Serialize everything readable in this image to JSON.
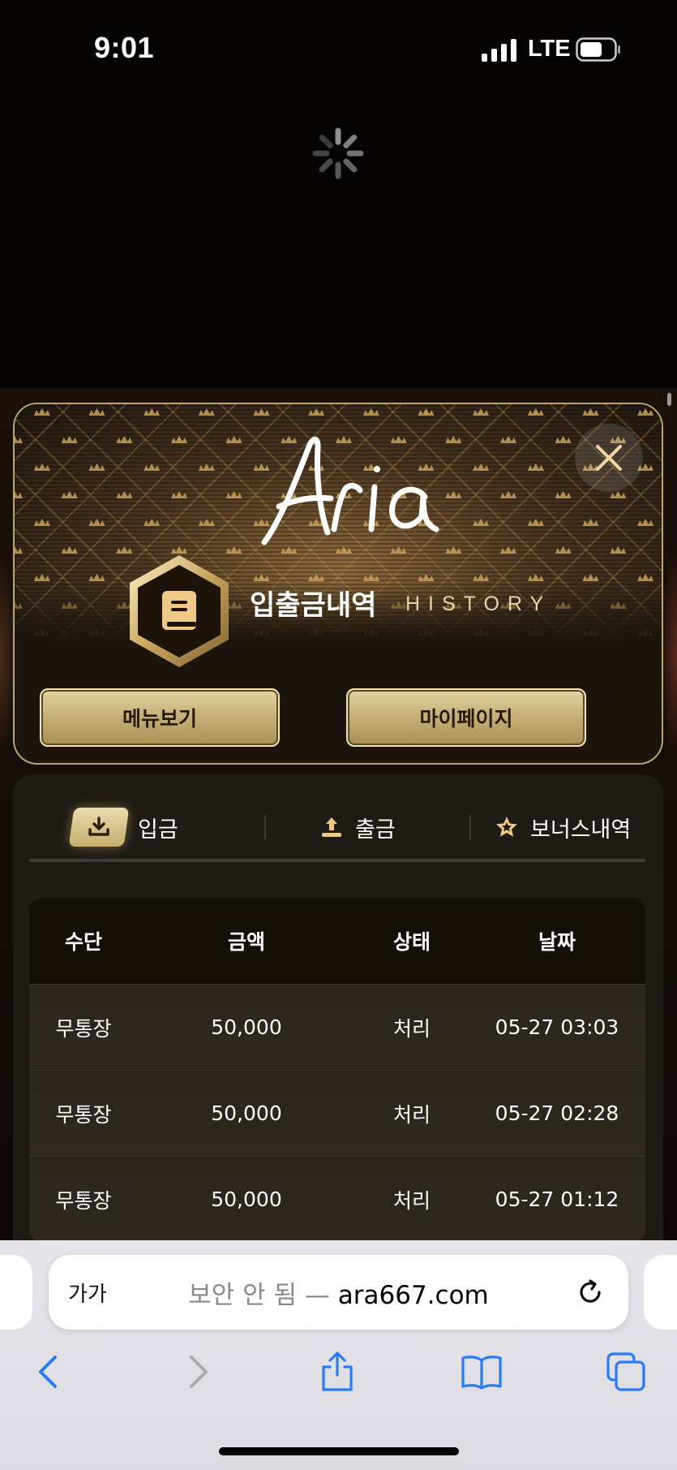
{
  "status_bar": {
    "time": "9:01",
    "network": "LTE"
  },
  "modal": {
    "logo_text": "Aria",
    "title_ko": "입출금내역",
    "title_en": "HISTORY",
    "menu_button": "메뉴보기",
    "mypage_button": "마이페이지"
  },
  "tabs": [
    {
      "label": "입금",
      "icon": "download-icon",
      "active": true
    },
    {
      "label": "출금",
      "icon": "upload-icon",
      "active": false
    },
    {
      "label": "보너스내역",
      "icon": "star-icon",
      "active": false
    }
  ],
  "table": {
    "headers": [
      "수단",
      "금액",
      "상태",
      "날짜"
    ],
    "rows": [
      [
        "무통장",
        "50,000",
        "처리",
        "05-27 03:03"
      ],
      [
        "무통장",
        "50,000",
        "처리",
        "05-27 02:28"
      ],
      [
        "무통장",
        "50,000",
        "처리",
        "05-27 01:12"
      ]
    ]
  },
  "browser": {
    "aa_label": "가가",
    "url_prefix": "보안 안 됨 —",
    "url": "ara667.com"
  },
  "colors": {
    "gold": "#c7b27a",
    "gold_border": "#b8a574",
    "panel_bg": "#1e1a14",
    "page_bg": "#070404"
  }
}
